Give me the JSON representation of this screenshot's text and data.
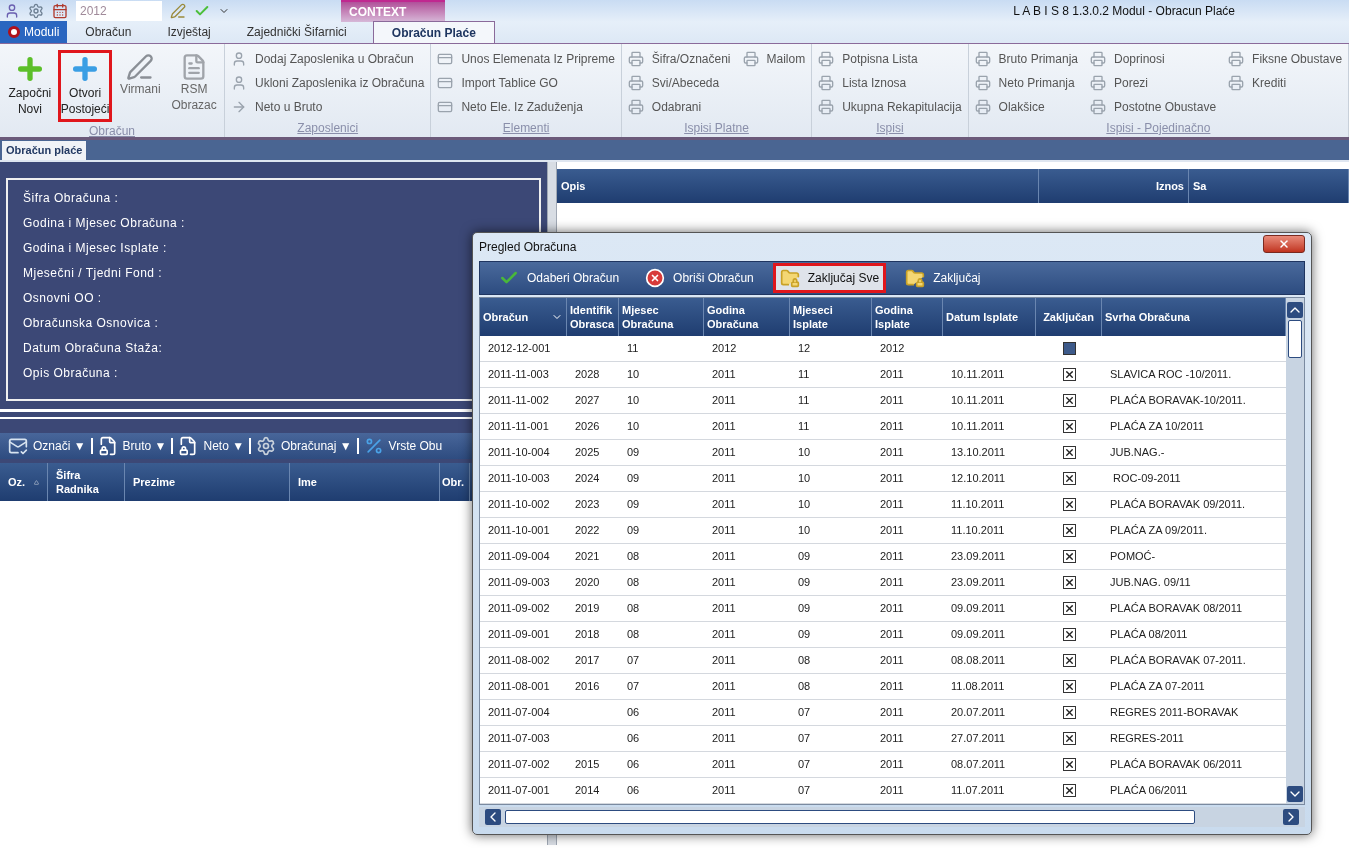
{
  "window": {
    "title": "L A B I S 8 1.3.0.2 Modul - Obracun Plaće"
  },
  "quick_access": {
    "year_field": "2012"
  },
  "context_tab": "CONTEXT",
  "tabs": [
    {
      "label": "Moduli",
      "kind": "app-menu",
      "selected": false
    },
    {
      "label": "Obračun",
      "kind": "tab",
      "selected": false
    },
    {
      "label": "Izvještaj",
      "kind": "tab",
      "selected": false
    },
    {
      "label": "Zajednički Šifarnici",
      "kind": "tab",
      "selected": false
    },
    {
      "label": "Obračun Plaće",
      "kind": "tab",
      "selected": true
    }
  ],
  "ribbon": {
    "big_group": {
      "title": "Obračun",
      "buttons": [
        {
          "label": "Započni Novi",
          "kind": "add-green",
          "highlighted": false
        },
        {
          "label": "Otvori Postojeći",
          "kind": "add-blue",
          "highlighted": true
        },
        {
          "label": "Virmani",
          "kind": "pen",
          "highlighted": false
        },
        {
          "label": "RSM Obrazac",
          "kind": "document",
          "highlighted": false
        }
      ]
    },
    "groups": [
      {
        "title": "Zaposlenici",
        "columns": [
          [
            {
              "label": "Dodaj Zaposlenika u Obračun",
              "kind": "person"
            },
            {
              "label": "Ukloni Zaposlenika iz Obračuna",
              "kind": "person"
            },
            {
              "label": "Neto u Bruto",
              "kind": "arrow"
            }
          ]
        ]
      },
      {
        "title": "Elementi",
        "columns": [
          [
            {
              "label": "Unos Elemenata Iz Pripreme",
              "kind": "card"
            },
            {
              "label": "Import Tablice GO",
              "kind": "card"
            },
            {
              "label": "Neto Ele. Iz Zaduženja",
              "kind": "card"
            }
          ]
        ]
      },
      {
        "title": "Ispisi Platne",
        "columns": [
          [
            {
              "label": "Šifra/Označeni",
              "kind": "printer"
            },
            {
              "label": "Svi/Abeceda",
              "kind": "printer"
            },
            {
              "label": "Odabrani",
              "kind": "printer"
            }
          ],
          [
            {
              "label": "Mailom",
              "kind": "printer"
            }
          ]
        ]
      },
      {
        "title": "Ispisi",
        "columns": [
          [
            {
              "label": "Potpisna Lista",
              "kind": "printer"
            },
            {
              "label": "Lista Iznosa",
              "kind": "printer"
            },
            {
              "label": "Ukupna Rekapitulacija",
              "kind": "printer"
            }
          ]
        ]
      },
      {
        "title": "Ispisi - Pojedinačno",
        "columns": [
          [
            {
              "label": "Bruto Primanja",
              "kind": "printer"
            },
            {
              "label": "Neto Primanja",
              "kind": "printer"
            },
            {
              "label": "Olakšice",
              "kind": "printer"
            }
          ],
          [
            {
              "label": "Doprinosi",
              "kind": "printer"
            },
            {
              "label": "Porezi",
              "kind": "printer"
            },
            {
              "label": "Postotne Obustave",
              "kind": "printer"
            }
          ],
          [
            {
              "label": "Fiksne Obustave",
              "kind": "printer"
            },
            {
              "label": "Krediti",
              "kind": "printer"
            }
          ]
        ]
      }
    ]
  },
  "document_tab": "Obračun plaće",
  "form_labels": [
    "Šifra Obračuna :",
    "Godina i Mjesec Obračuna :",
    "Godina i Mjesec Isplate :",
    "Mjesečni / Tjedni Fond :",
    "Osnovni OO :",
    "Obračunska Osnovica :",
    "Datum Obračuna Staža:",
    "Opis Obračuna :"
  ],
  "employee_toolbar": [
    {
      "label": "Označi ▼",
      "kind": "mark"
    },
    {
      "label": "Bruto ▼",
      "kind": "doc-lock"
    },
    {
      "label": "Neto ▼",
      "kind": "doc-lock"
    },
    {
      "label": "Obračunaj ▼",
      "kind": "gear"
    },
    {
      "label": "Vrste Obu",
      "kind": "percent"
    }
  ],
  "employee_table": {
    "columns": [
      "Oz.",
      "Šifra Radnika",
      "Prezime",
      "Ime",
      "Obr."
    ]
  },
  "right_table": {
    "columns": [
      "Opis",
      "Iznos",
      "Sa"
    ]
  },
  "dialog": {
    "title": "Pregled Obračuna",
    "toolbar": [
      {
        "label": "Odaberi Obračun",
        "kind": "check",
        "highlighted": false
      },
      {
        "label": "Obriši Obračun",
        "kind": "delete",
        "highlighted": false
      },
      {
        "label": "Zaključaj Sve",
        "kind": "lock",
        "highlighted": true
      },
      {
        "label": "Zaključaj",
        "kind": "lock",
        "highlighted": false
      }
    ],
    "columns": [
      "Obračun",
      "Identifik Obrasca",
      "Mjesec Obračuna",
      "Godina Obračuna",
      "Mjeseci Isplate",
      "Godina Isplate",
      "Datum Isplate",
      "Zaključan",
      "Svrha Obračuna"
    ],
    "rows": [
      {
        "obracun": "2012-12-001",
        "identifik": "",
        "mjesec": "11",
        "godina": "2012",
        "mjeseci_isplate": "12",
        "godina_isplate": "2012",
        "datum": "",
        "locked": false,
        "svrha": ""
      },
      {
        "obracun": "2011-11-003",
        "identifik": "2028",
        "mjesec": "10",
        "godina": "2011",
        "mjeseci_isplate": "11",
        "godina_isplate": "2011",
        "datum": "10.11.2011",
        "locked": true,
        "svrha": "SLAVICA ROC -10/2011."
      },
      {
        "obracun": "2011-11-002",
        "identifik": "2027",
        "mjesec": "10",
        "godina": "2011",
        "mjeseci_isplate": "11",
        "godina_isplate": "2011",
        "datum": "10.11.2011",
        "locked": true,
        "svrha": "PLAĆA BORAVAK-10/2011."
      },
      {
        "obracun": "2011-11-001",
        "identifik": "2026",
        "mjesec": "10",
        "godina": "2011",
        "mjeseci_isplate": "11",
        "godina_isplate": "2011",
        "datum": "10.11.2011",
        "locked": true,
        "svrha": "PLAĆA ZA 10/2011"
      },
      {
        "obracun": "2011-10-004",
        "identifik": "2025",
        "mjesec": "09",
        "godina": "2011",
        "mjeseci_isplate": "10",
        "godina_isplate": "2011",
        "datum": "13.10.2011",
        "locked": true,
        "svrha": "JUB.NAG.-"
      },
      {
        "obracun": "2011-10-003",
        "identifik": "2024",
        "mjesec": "09",
        "godina": "2011",
        "mjeseci_isplate": "10",
        "godina_isplate": "2011",
        "datum": "12.10.2011",
        "locked": true,
        "svrha": " ROC-09-2011"
      },
      {
        "obracun": "2011-10-002",
        "identifik": "2023",
        "mjesec": "09",
        "godina": "2011",
        "mjeseci_isplate": "10",
        "godina_isplate": "2011",
        "datum": "11.10.2011",
        "locked": true,
        "svrha": "PLAĆA BORAVAK 09/2011."
      },
      {
        "obracun": "2011-10-001",
        "identifik": "2022",
        "mjesec": "09",
        "godina": "2011",
        "mjeseci_isplate": "10",
        "godina_isplate": "2011",
        "datum": "11.10.2011",
        "locked": true,
        "svrha": "PLAĆA ZA 09/2011."
      },
      {
        "obracun": "2011-09-004",
        "identifik": "2021",
        "mjesec": "08",
        "godina": "2011",
        "mjeseci_isplate": "09",
        "godina_isplate": "2011",
        "datum": "23.09.2011",
        "locked": true,
        "svrha": "POMOĆ-"
      },
      {
        "obracun": "2011-09-003",
        "identifik": "2020",
        "mjesec": "08",
        "godina": "2011",
        "mjeseci_isplate": "09",
        "godina_isplate": "2011",
        "datum": "23.09.2011",
        "locked": true,
        "svrha": "JUB.NAG. 09/11"
      },
      {
        "obracun": "2011-09-002",
        "identifik": "2019",
        "mjesec": "08",
        "godina": "2011",
        "mjeseci_isplate": "09",
        "godina_isplate": "2011",
        "datum": "09.09.2011",
        "locked": true,
        "svrha": "PLAĆA BORAVAK 08/2011"
      },
      {
        "obracun": "2011-09-001",
        "identifik": "2018",
        "mjesec": "08",
        "godina": "2011",
        "mjeseci_isplate": "09",
        "godina_isplate": "2011",
        "datum": "09.09.2011",
        "locked": true,
        "svrha": "PLAĆA 08/2011"
      },
      {
        "obracun": "2011-08-002",
        "identifik": "2017",
        "mjesec": "07",
        "godina": "2011",
        "mjeseci_isplate": "08",
        "godina_isplate": "2011",
        "datum": "08.08.2011",
        "locked": true,
        "svrha": "PLAĆA BORAVAK 07-2011."
      },
      {
        "obracun": "2011-08-001",
        "identifik": "2016",
        "mjesec": "07",
        "godina": "2011",
        "mjeseci_isplate": "08",
        "godina_isplate": "2011",
        "datum": "11.08.2011",
        "locked": true,
        "svrha": "PLAĆA ZA 07-2011"
      },
      {
        "obracun": "2011-07-004",
        "identifik": "",
        "mjesec": "06",
        "godina": "2011",
        "mjeseci_isplate": "07",
        "godina_isplate": "2011",
        "datum": "20.07.2011",
        "locked": true,
        "svrha": "REGRES 2011-BORAVAK"
      },
      {
        "obracun": "2011-07-003",
        "identifik": "",
        "mjesec": "06",
        "godina": "2011",
        "mjeseci_isplate": "07",
        "godina_isplate": "2011",
        "datum": "27.07.2011",
        "locked": true,
        "svrha": "REGRES-2011"
      },
      {
        "obracun": "2011-07-002",
        "identifik": "2015",
        "mjesec": "06",
        "godina": "2011",
        "mjeseci_isplate": "07",
        "godina_isplate": "2011",
        "datum": "08.07.2011",
        "locked": true,
        "svrha": "PLAĆA BORAVAK 06/2011"
      },
      {
        "obracun": "2011-07-001",
        "identifik": "2014",
        "mjesec": "06",
        "godina": "2011",
        "mjeseci_isplate": "07",
        "godina_isplate": "2011",
        "datum": "11.07.2011",
        "locked": true,
        "svrha": "PLAĆA 06/2011"
      }
    ]
  }
}
